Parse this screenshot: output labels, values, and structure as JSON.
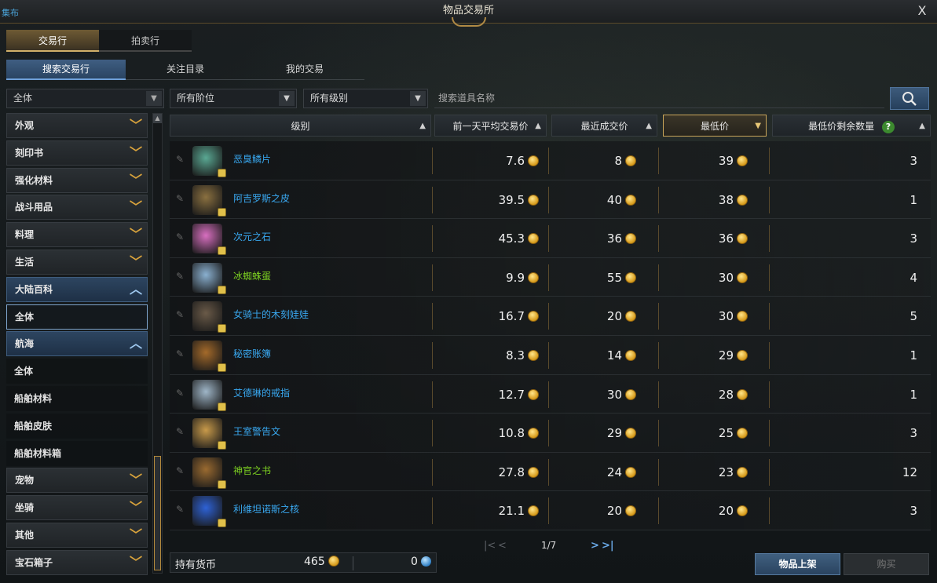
{
  "window": {
    "title": "物品交易所",
    "left_fragment": "集布",
    "close_label": "X"
  },
  "main_tabs": [
    "交易行",
    "拍卖行"
  ],
  "sub_tabs": [
    "搜索交易行",
    "关注目录",
    "我的交易"
  ],
  "sidebar": {
    "select_value": "全体",
    "items": [
      {
        "label": "外观",
        "kind": "cat"
      },
      {
        "label": "刻印书",
        "kind": "cat"
      },
      {
        "label": "强化材料",
        "kind": "cat"
      },
      {
        "label": "战斗用品",
        "kind": "cat"
      },
      {
        "label": "料理",
        "kind": "cat"
      },
      {
        "label": "生活",
        "kind": "cat"
      },
      {
        "label": "大陆百科",
        "kind": "open"
      },
      {
        "label": "全体",
        "kind": "selected"
      },
      {
        "label": "航海",
        "kind": "open"
      },
      {
        "label": "全体",
        "kind": "sub"
      },
      {
        "label": "船舶材料",
        "kind": "sub"
      },
      {
        "label": "船舶皮肤",
        "kind": "sub"
      },
      {
        "label": "船舶材料箱",
        "kind": "sub"
      },
      {
        "label": "宠物",
        "kind": "cat"
      },
      {
        "label": "坐骑",
        "kind": "cat"
      },
      {
        "label": "其他",
        "kind": "cat"
      },
      {
        "label": "宝石箱子",
        "kind": "cat"
      }
    ]
  },
  "filters": {
    "tier": "所有阶位",
    "grade": "所有级别",
    "search_placeholder": "搜索道具名称"
  },
  "columns": {
    "grade": "级别",
    "avg_price": "前一天平均交易价",
    "recent_price": "最近成交价",
    "min_price": "最低价",
    "min_qty": "最低价剩余数量"
  },
  "sort_icons": {
    "asc": "▲",
    "desc": "▼"
  },
  "rows": [
    {
      "name": "恶臭鳞片",
      "avg": "7.6",
      "recent": "8",
      "min": "39",
      "qty": "3",
      "color": "#39a8f0",
      "icon": "scale-icon",
      "icon_color": "#5aa893"
    },
    {
      "name": "阿吉罗斯之皮",
      "avg": "39.5",
      "recent": "40",
      "min": "38",
      "qty": "1",
      "color": "#39a8f0",
      "icon": "hide-icon",
      "icon_color": "#8a7040"
    },
    {
      "name": "次元之石",
      "avg": "45.3",
      "recent": "36",
      "min": "36",
      "qty": "3",
      "color": "#39a8f0",
      "icon": "stone-icon",
      "icon_color": "#d86fc0"
    },
    {
      "name": "冰蜘蛛蛋",
      "avg": "9.9",
      "recent": "55",
      "min": "30",
      "qty": "4",
      "color": "#7ed321",
      "icon": "egg-icon",
      "icon_color": "#8ab0d0"
    },
    {
      "name": "女骑士的木刻娃娃",
      "avg": "16.7",
      "recent": "20",
      "min": "30",
      "qty": "5",
      "color": "#39a8f0",
      "icon": "doll-icon",
      "icon_color": "#6a5a48"
    },
    {
      "name": "秘密账簿",
      "avg": "8.3",
      "recent": "14",
      "min": "29",
      "qty": "1",
      "color": "#39a8f0",
      "icon": "book-icon",
      "icon_color": "#a46a2a"
    },
    {
      "name": "艾德琳的戒指",
      "avg": "12.7",
      "recent": "30",
      "min": "28",
      "qty": "1",
      "color": "#39a8f0",
      "icon": "ring-icon",
      "icon_color": "#9fb6c8"
    },
    {
      "name": "王室警告文",
      "avg": "10.8",
      "recent": "29",
      "min": "25",
      "qty": "3",
      "color": "#39a8f0",
      "icon": "scroll-icon",
      "icon_color": "#c89a4a"
    },
    {
      "name": "神官之书",
      "avg": "27.8",
      "recent": "24",
      "min": "23",
      "qty": "12",
      "color": "#7ed321",
      "icon": "tome-icon",
      "icon_color": "#9a6a30"
    },
    {
      "name": "利维坦诺斯之核",
      "avg": "21.1",
      "recent": "20",
      "min": "20",
      "qty": "3",
      "color": "#39a8f0",
      "icon": "core-icon",
      "icon_color": "#2e62d6"
    }
  ],
  "pagination": {
    "first": "|<",
    "prev": "<",
    "label": "1/7",
    "next": ">",
    "last": ">|"
  },
  "currency": {
    "label": "持有货币",
    "gold": "465",
    "gems": "0"
  },
  "buttons": {
    "list_item": "物品上架",
    "buy": "购买"
  }
}
